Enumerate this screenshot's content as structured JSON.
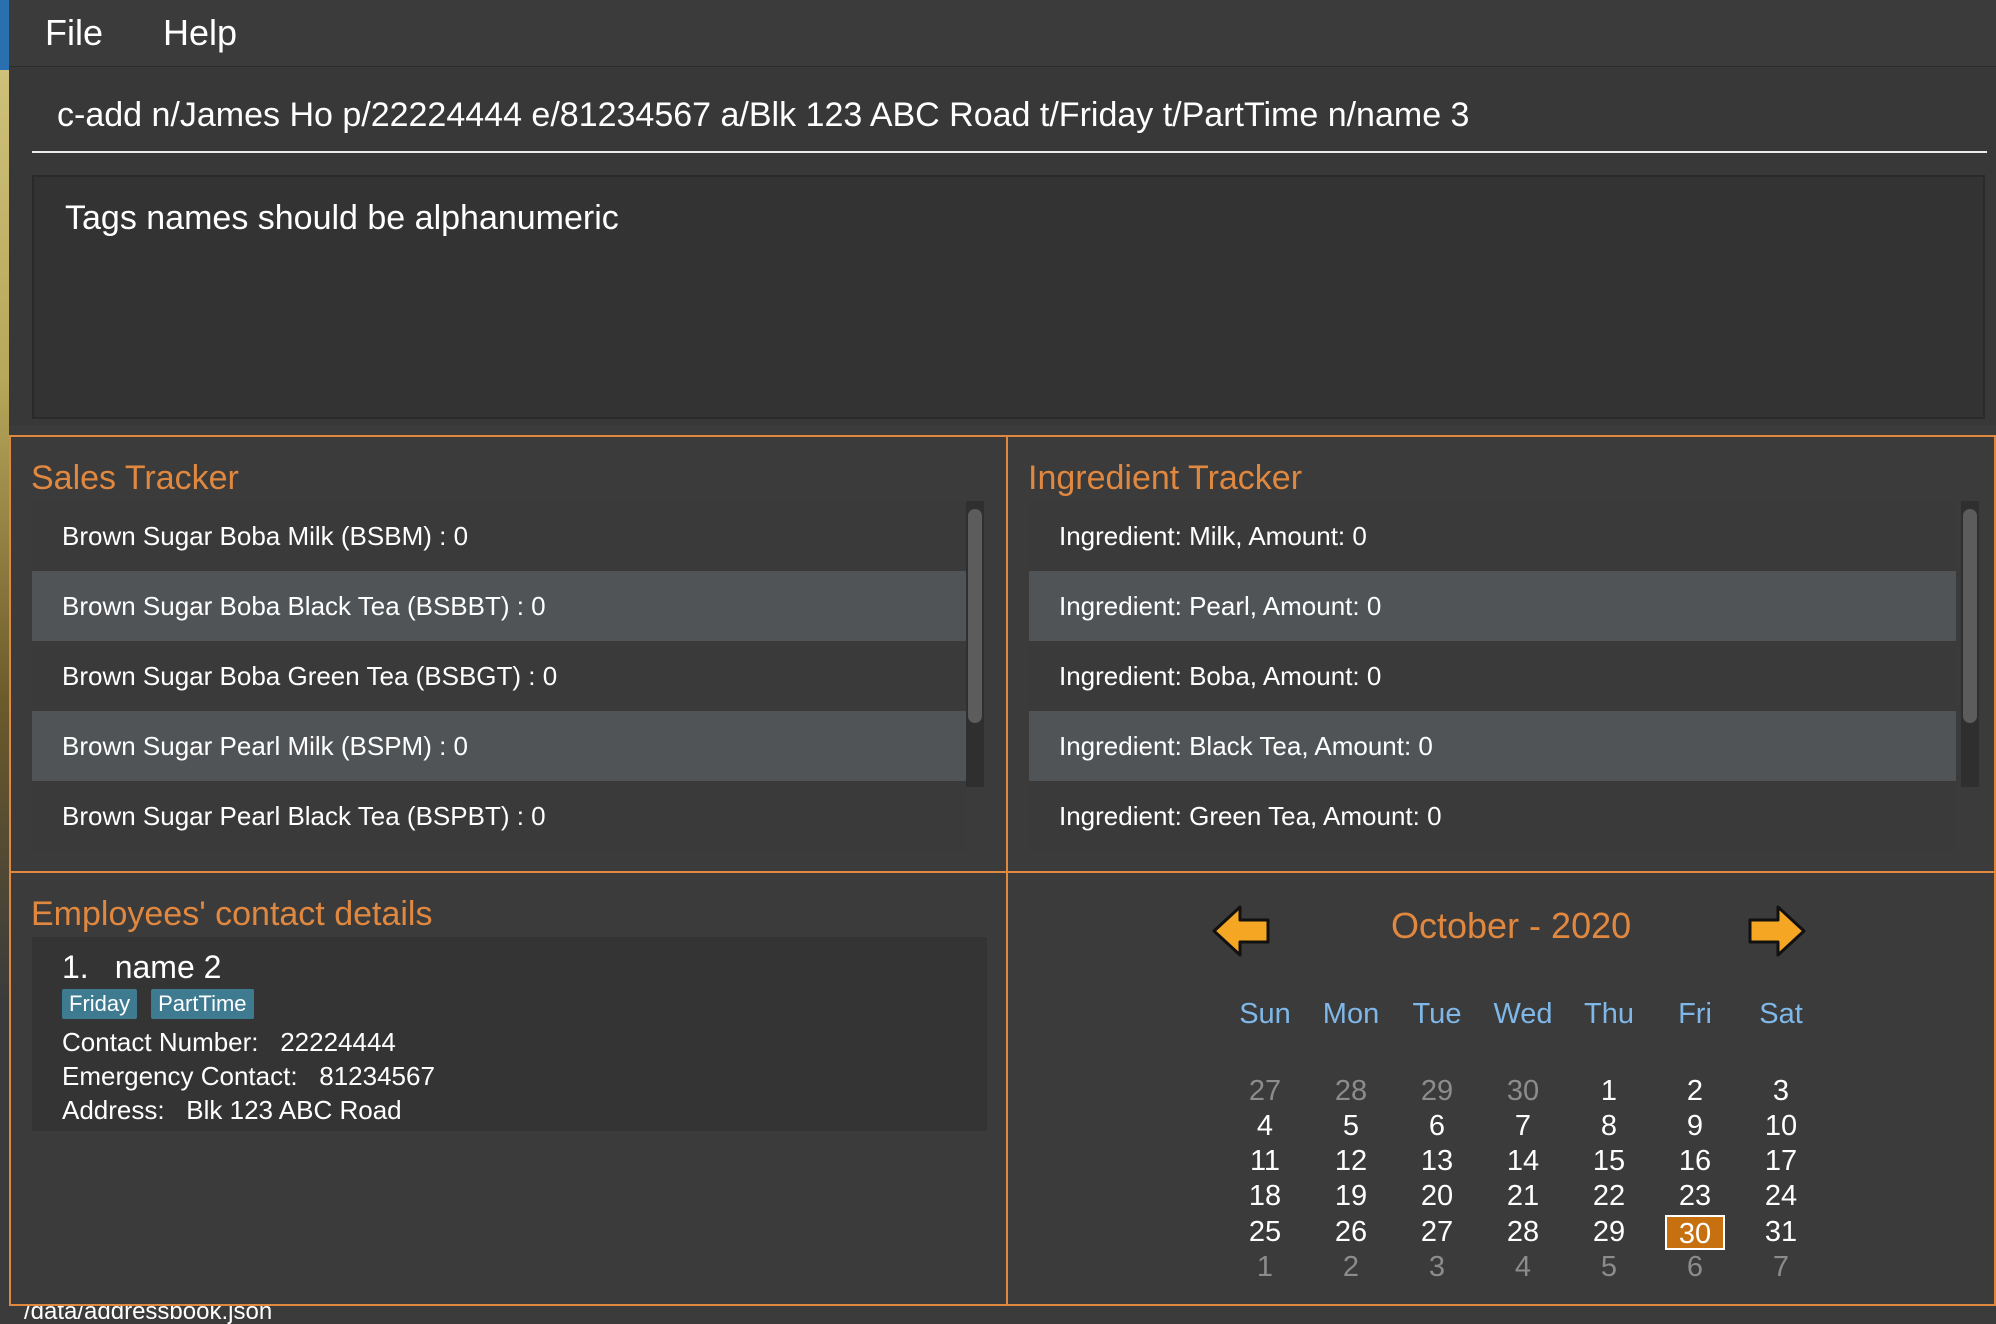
{
  "menu": {
    "file_label": "File",
    "help_label": "Help"
  },
  "command": {
    "value": "c-add n/James Ho p/22224444 e/81234567 a/Blk 123 ABC Road t/Friday t/PartTime n/name 3"
  },
  "result": {
    "message": "Tags names should be alphanumeric"
  },
  "sales": {
    "title": "Sales Tracker",
    "items": [
      "Brown Sugar Boba Milk (BSBM) : 0",
      "Brown Sugar Boba Black Tea (BSBBT) : 0",
      "Brown Sugar Boba Green Tea (BSBGT) : 0",
      "Brown Sugar Pearl Milk (BSPM) : 0",
      "Brown Sugar Pearl Black Tea (BSPBT) : 0"
    ]
  },
  "ingredients": {
    "title": "Ingredient Tracker",
    "items": [
      "Ingredient: Milk,  Amount: 0",
      "Ingredient: Pearl,  Amount: 0",
      "Ingredient: Boba,  Amount: 0",
      "Ingredient: Black Tea,  Amount: 0",
      "Ingredient: Green Tea,  Amount: 0"
    ]
  },
  "employees": {
    "title": "Employees' contact details",
    "list": [
      {
        "index": "1.",
        "name": "name 2",
        "tags": [
          "Friday",
          "PartTime"
        ],
        "contact_label": "Contact Number:",
        "contact": "22224444",
        "emergency_label": "Emergency Contact:",
        "emergency": "81234567",
        "address_label": "Address:",
        "address": "Blk 123 ABC Road"
      }
    ]
  },
  "calendar": {
    "title": "October - 2020",
    "prev_icon": "left-arrow-icon",
    "next_icon": "right-arrow-icon",
    "days_of_week": [
      "Sun",
      "Mon",
      "Tue",
      "Wed",
      "Thu",
      "Fri",
      "Sat"
    ],
    "weeks": [
      [
        "27",
        "28",
        "29",
        "30",
        "1",
        "2",
        "3"
      ],
      [
        "4",
        "5",
        "6",
        "7",
        "8",
        "9",
        "10"
      ],
      [
        "11",
        "12",
        "13",
        "14",
        "15",
        "16",
        "17"
      ],
      [
        "18",
        "19",
        "20",
        "21",
        "22",
        "23",
        "24"
      ],
      [
        "25",
        "26",
        "27",
        "28",
        "29",
        "30",
        "31"
      ],
      [
        "1",
        "2",
        "3",
        "4",
        "5",
        "6",
        "7"
      ]
    ],
    "today": "30",
    "colors": {
      "accent": "#e0883f",
      "today_bg": "#c7700f",
      "weekday_header": "#7fb8e8",
      "arrow_fill": "#f5a623"
    }
  },
  "status": {
    "path": "/data/addressbook.json"
  }
}
